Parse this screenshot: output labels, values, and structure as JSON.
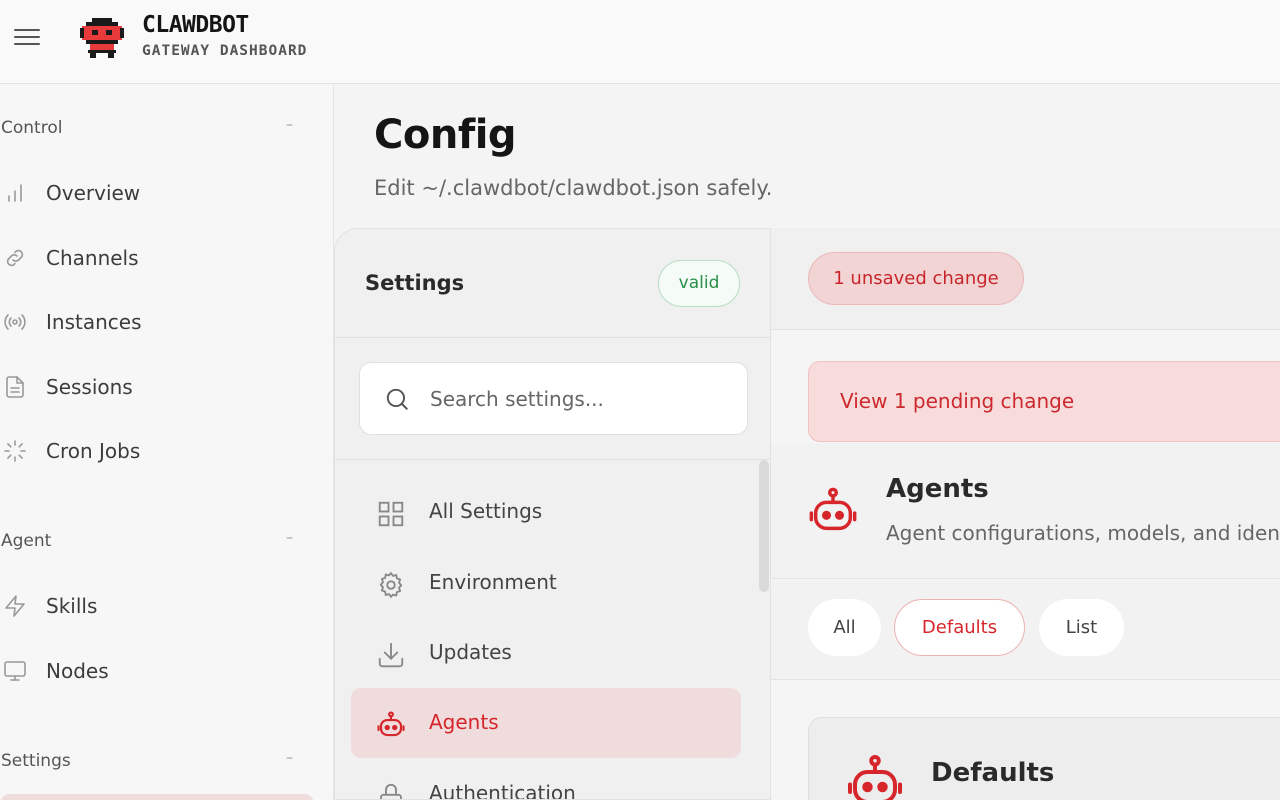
{
  "brand": {
    "title": "CLAWDBOT",
    "subtitle": "GATEWAY DASHBOARD"
  },
  "sidebar": {
    "sections": [
      {
        "label": "Control",
        "toggle": "–"
      },
      {
        "label": "Agent",
        "toggle": "–"
      },
      {
        "label": "Settings",
        "toggle": "–"
      }
    ],
    "control_items": [
      {
        "label": "Overview",
        "icon": "bar-chart-icon"
      },
      {
        "label": "Channels",
        "icon": "link-icon"
      },
      {
        "label": "Instances",
        "icon": "broadcast-icon"
      },
      {
        "label": "Sessions",
        "icon": "document-icon"
      },
      {
        "label": "Cron Jobs",
        "icon": "loader-icon"
      }
    ],
    "agent_items": [
      {
        "label": "Skills",
        "icon": "lightning-icon"
      },
      {
        "label": "Nodes",
        "icon": "monitor-icon"
      }
    ]
  },
  "page": {
    "title": "Config",
    "subtitle": "Edit ~/.clawdbot/clawdbot.json safely."
  },
  "settings": {
    "title": "Settings",
    "status_badge": "valid",
    "search_placeholder": "Search settings...",
    "items": [
      {
        "label": "All Settings",
        "icon": "grid-icon"
      },
      {
        "label": "Environment",
        "icon": "gear-icon"
      },
      {
        "label": "Updates",
        "icon": "download-icon"
      },
      {
        "label": "Agents",
        "icon": "robot-icon",
        "active": true
      },
      {
        "label": "Authentication",
        "icon": "lock-icon"
      }
    ]
  },
  "editor": {
    "unsaved_label": "1 unsaved change",
    "pending_label": "View 1 pending change",
    "section_title": "Agents",
    "section_desc": "Agent configurations, models, and identities",
    "filters": [
      "All",
      "Defaults",
      "List"
    ],
    "active_filter": "Defaults",
    "card_title": "Defaults"
  },
  "colors": {
    "accent": "#d6262b",
    "valid": "#27904a",
    "active_bg": "#f0dcdc"
  }
}
